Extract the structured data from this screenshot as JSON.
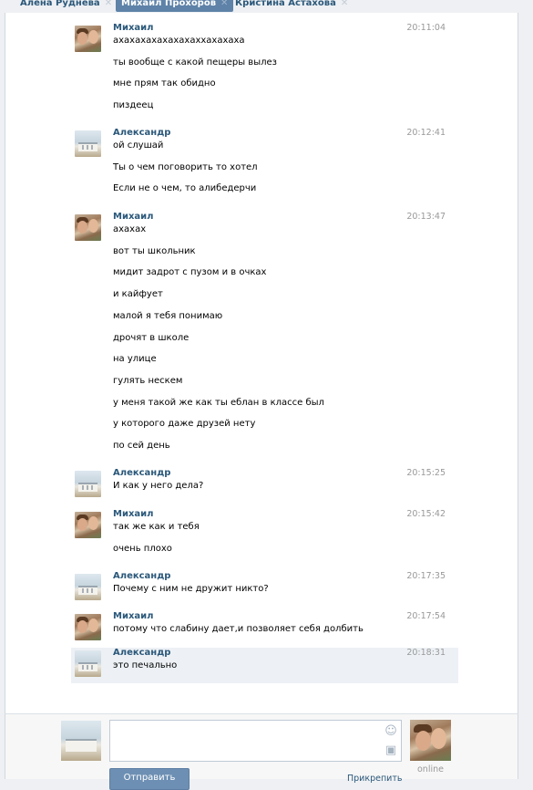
{
  "tabs": [
    {
      "label": "Алена Руднева",
      "active": false
    },
    {
      "label": "Михаил Прохоров",
      "active": true
    },
    {
      "label": "Кристина Астахова",
      "active": false
    }
  ],
  "tab_close_glyph": "✕",
  "messages": [
    {
      "author": "Михаил",
      "avatar": "mikhail",
      "time": "20:11:04",
      "lines": [
        "ахахахахахахахаххахахаха",
        "ты вообще с какой пещеры вылез",
        "мне прям так обидно",
        "пиздеец"
      ]
    },
    {
      "author": "Александр",
      "avatar": "alexander",
      "time": "20:12:41",
      "lines": [
        "ой слушай",
        "Ты о чем поговорить то хотел",
        "Если не о чем, то алибедерчи"
      ]
    },
    {
      "author": "Михаил",
      "avatar": "mikhail",
      "time": "20:13:47",
      "lines": [
        "ахахах",
        "вот ты школьник",
        "мидит задрот с пузом и в очках",
        "и кайфует",
        "малой я тебя понимаю",
        "дрочят в школе",
        "на улице",
        "гулять нескем",
        "у меня такой же как ты еблан в классе был",
        "у которого даже друзей нету",
        "по сей день"
      ]
    },
    {
      "author": "Александр",
      "avatar": "alexander",
      "time": "20:15:25",
      "lines": [
        "И как у него дела?"
      ]
    },
    {
      "author": "Михаил",
      "avatar": "mikhail",
      "time": "20:15:42",
      "lines": [
        "так же как и тебя",
        "очень плохо"
      ]
    },
    {
      "author": "Александр",
      "avatar": "alexander",
      "time": "20:17:35",
      "lines": [
        "Почему с ним не дружит никто?"
      ]
    },
    {
      "author": "Михаил",
      "avatar": "mikhail",
      "time": "20:17:54",
      "lines": [
        "потому что слабину дает,и позволяет себя долбить"
      ]
    },
    {
      "author": "Александр",
      "avatar": "alexander",
      "time": "20:18:31",
      "lines": [
        "это печально"
      ],
      "highlighted": true
    }
  ],
  "compose": {
    "input_value": "",
    "smile_icon": "☺",
    "camera_icon": "▣",
    "send_label": "Отправить",
    "attach_label": "Прикрепить",
    "peer_status": "online"
  }
}
